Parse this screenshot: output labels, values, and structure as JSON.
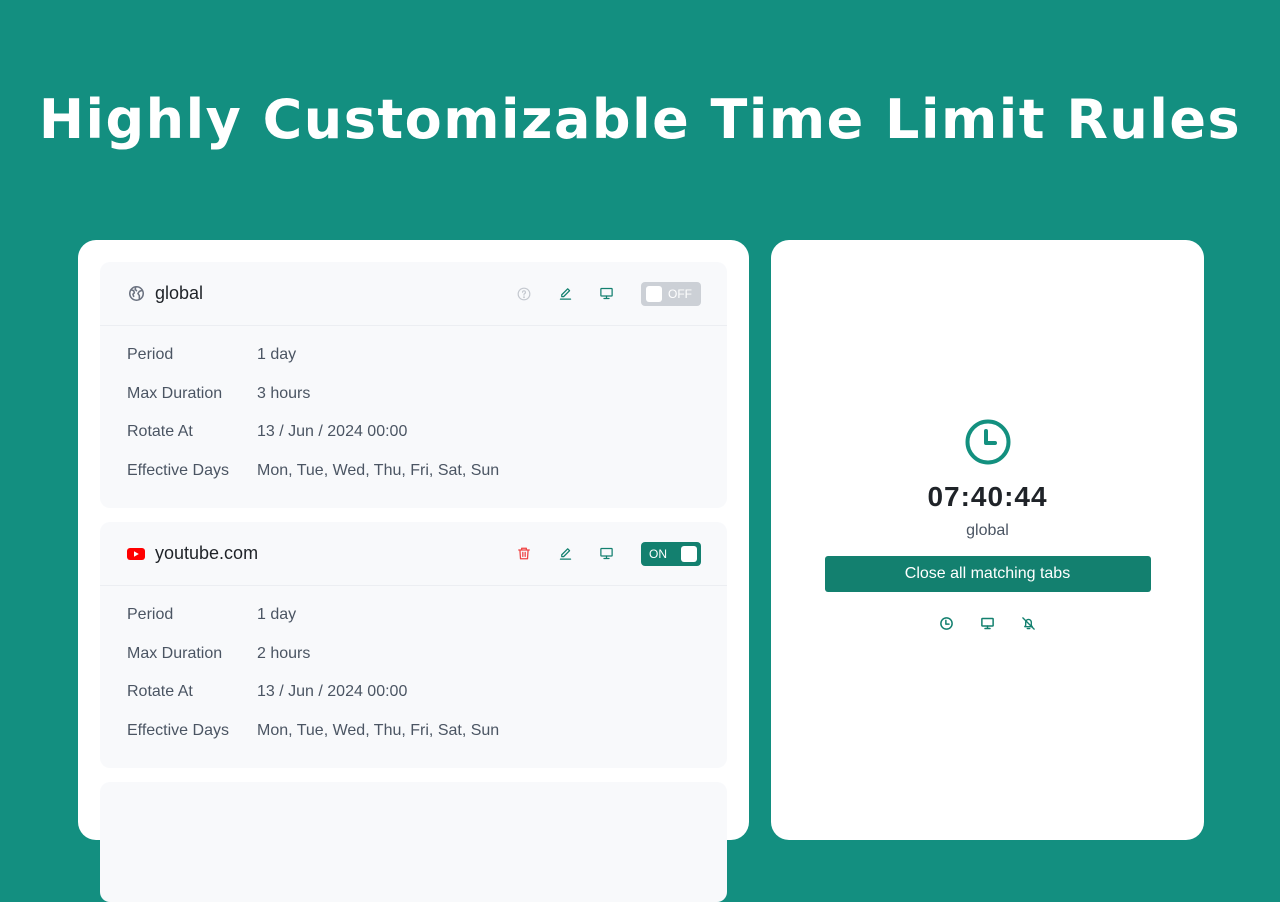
{
  "headline": "Highly Customizable Time Limit Rules",
  "colors": {
    "background": "#138f80",
    "accent": "#13806f",
    "danger": "#ef4444",
    "toggle_off": "#ccd0d6"
  },
  "rules": [
    {
      "name": "global",
      "icon": "globe-icon",
      "actions": [
        "help-icon",
        "edit-icon",
        "monitor-icon"
      ],
      "toggle": {
        "state": "off",
        "label": "OFF"
      },
      "fields": [
        {
          "label": "Period",
          "value": "1 day"
        },
        {
          "label": "Max Duration",
          "value": "3 hours"
        },
        {
          "label": "Rotate At",
          "value": "13 / Jun / 2024 00:00"
        },
        {
          "label": "Effective Days",
          "value": "Mon, Tue, Wed, Thu, Fri, Sat, Sun"
        }
      ]
    },
    {
      "name": "youtube.com",
      "icon": "youtube-icon",
      "actions": [
        "trash-icon",
        "edit-icon",
        "monitor-icon"
      ],
      "toggle": {
        "state": "on",
        "label": "ON"
      },
      "fields": [
        {
          "label": "Period",
          "value": "1 day"
        },
        {
          "label": "Max Duration",
          "value": "2 hours"
        },
        {
          "label": "Rotate At",
          "value": "13 / Jun / 2024 00:00"
        },
        {
          "label": "Effective Days",
          "value": "Mon, Tue, Wed, Thu, Fri, Sat, Sun"
        }
      ]
    }
  ],
  "status": {
    "icon": "clock-icon",
    "remaining": "07:40:44",
    "rule_name": "global",
    "close_button": "Close all matching tabs",
    "mini_actions": [
      "clock-icon",
      "monitor-icon",
      "bell-off-icon"
    ]
  }
}
